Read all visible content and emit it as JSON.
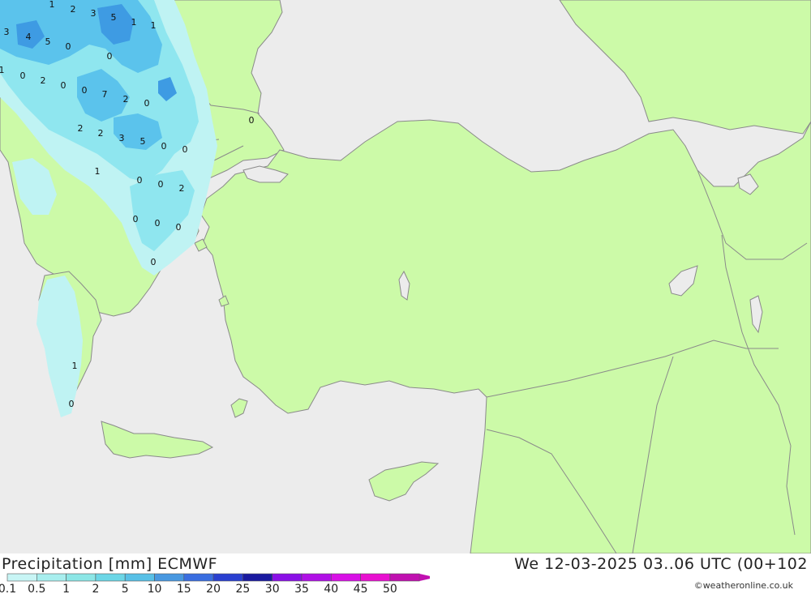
{
  "footer": {
    "title": "Precipitation [mm] ECMWF",
    "validity": "We 12-03-2025 03..06 UTC (00+102",
    "credit": "©weatheronline.co.uk"
  },
  "legend": {
    "ticks": [
      "0.1",
      "0.5",
      "1",
      "2",
      "5",
      "10",
      "15",
      "20",
      "25",
      "30",
      "35",
      "40",
      "45",
      "50"
    ],
    "colors": [
      "#c8f5f5",
      "#a8eeee",
      "#8ce6e6",
      "#6cd6e6",
      "#58c0e6",
      "#4898e0",
      "#3a6ee0",
      "#2a40d0",
      "#1a1aa0",
      "#8a10e6",
      "#b010e6",
      "#d810e6",
      "#e810d0",
      "#c010b0"
    ]
  },
  "map": {
    "colors": {
      "sea": "#ececec",
      "land": "#ccfaa8",
      "border": "#8a8a8a",
      "precip_light": "#bff3f3",
      "precip_mid": "#8fe6ef",
      "precip_heavy": "#5bc3ec",
      "precip_max": "#3e9be3"
    },
    "labels": [
      {
        "t": "1"
      },
      {
        "t": "2"
      },
      {
        "t": "3"
      },
      {
        "t": "5"
      },
      {
        "t": "1"
      },
      {
        "t": "1"
      },
      {
        "t": "3"
      },
      {
        "t": "4"
      },
      {
        "t": "5"
      },
      {
        "t": "0"
      },
      {
        "t": "0"
      },
      {
        "t": "1"
      },
      {
        "t": "0"
      },
      {
        "t": "2"
      },
      {
        "t": "0"
      },
      {
        "t": "0"
      },
      {
        "t": "7"
      },
      {
        "t": "2"
      },
      {
        "t": "0"
      },
      {
        "t": "0"
      },
      {
        "t": "2"
      },
      {
        "t": "2"
      },
      {
        "t": "3"
      },
      {
        "t": "5"
      },
      {
        "t": "0"
      },
      {
        "t": "0"
      },
      {
        "t": "1"
      },
      {
        "t": "0"
      },
      {
        "t": "0"
      },
      {
        "t": "2"
      },
      {
        "t": "0"
      },
      {
        "t": "0"
      },
      {
        "t": "0"
      },
      {
        "t": "0"
      },
      {
        "t": "1"
      },
      {
        "t": "0"
      }
    ]
  }
}
